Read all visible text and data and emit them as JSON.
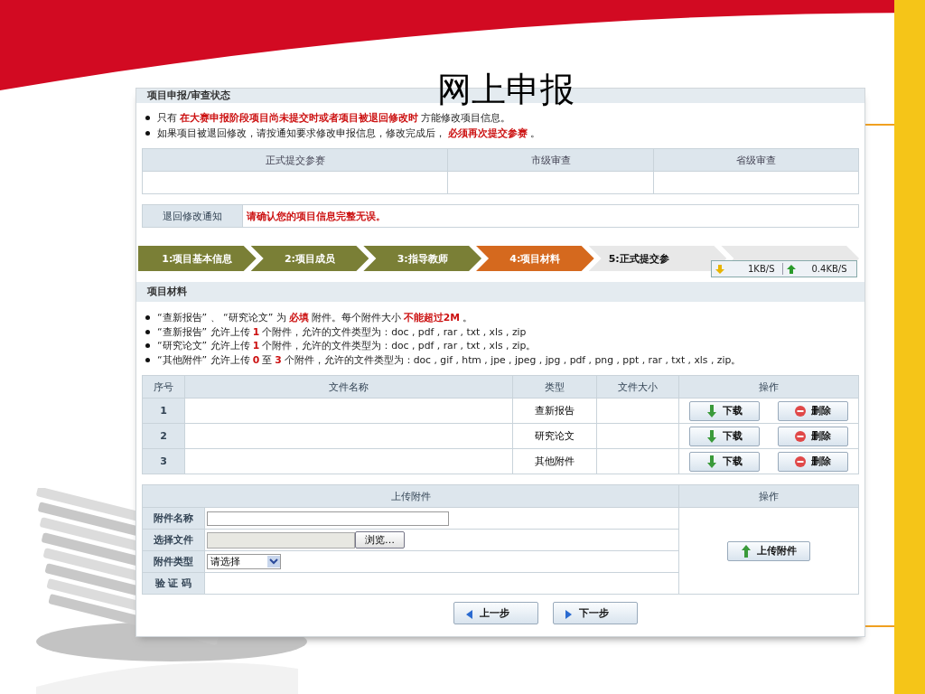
{
  "slide": {
    "title": "网上申报"
  },
  "panel_title": "项目申报/审查状态",
  "notices": [
    "只有 **在大赛申报阶段项目尚未提交时或者项目被退回修改时** 方能修改项目信息。",
    "如果项目被退回修改，请按通知要求修改申报信息，修改完成后， **必须再次提交参赛** 。"
  ],
  "status_table": {
    "columns": [
      "正式提交参赛",
      "市级审查",
      "省级审查"
    ]
  },
  "return_notice": {
    "label": "退回修改通知",
    "message": "请确认您的项目信息完整无误。"
  },
  "steps": [
    {
      "label": "1:项目基本信息",
      "completed": true,
      "selected": false
    },
    {
      "label": "2:项目成员",
      "completed": true,
      "selected": false
    },
    {
      "label": "3:指导教师",
      "completed": true,
      "selected": false
    },
    {
      "label": "4:项目材料",
      "completed": false,
      "selected": true
    },
    {
      "label": "5:正式提交参",
      "completed": false,
      "selected": false
    },
    {
      "completed": false,
      "selected": false
    }
  ],
  "speed_meter": {
    "download": "1KB/S",
    "upload": "0.4KB/S"
  },
  "materials": {
    "title": "项目材料",
    "notes": [
      "“查新报告” 、 “研究论文” 为 **必填** 附件。每个附件大小 **不能超过2M** 。",
      "“查新报告” 允许上传 **1** 个附件，允许的文件类型为：doc , pdf , rar , txt , xls , zip",
      "“研究论文” 允许上传 **1** 个附件，允许的文件类型为：doc , pdf , rar , txt , xls , zip。",
      "“其他附件” 允许上传 **0** 至 **3** 个附件，允许的文件类型为：doc , gif , htm , jpe , jpeg , jpg , pdf , png , ppt , rar , txt , xls , zip。"
    ],
    "columns": [
      "序号",
      "文件名称",
      "类型",
      "文件大小",
      "操作"
    ],
    "rows": [
      {
        "index": "1",
        "type": "查新报告",
        "download": "下载",
        "delete": "删除"
      },
      {
        "index": "2",
        "type": "研究论文",
        "download": "下载",
        "delete": "删除"
      },
      {
        "index": "3",
        "type": "其他附件",
        "download": "下载",
        "delete": "删除"
      }
    ]
  },
  "upload": {
    "title": "上传附件",
    "action_title": "操作",
    "fields": [
      {
        "label": "附件名称",
        "kind": "text"
      },
      {
        "label": "选择文件",
        "kind": "file",
        "button": "浏览…"
      },
      {
        "label": "附件类型",
        "kind": "select",
        "value": "请选择"
      },
      {
        "label": "验 证 码",
        "kind": "blank"
      }
    ],
    "submit": "上传附件"
  },
  "nav": {
    "prev": "上一步",
    "next": "下一步"
  }
}
